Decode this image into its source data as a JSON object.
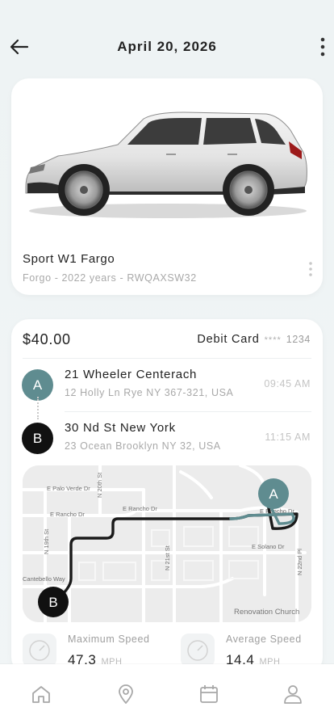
{
  "header": {
    "title": "April 20, 2026",
    "back_icon": "arrow-left-icon",
    "more_icon": "more-vertical-icon"
  },
  "vehicle": {
    "name": "Sport W1 Fargo",
    "meta": "Forgo - 2022 years - RWQAXSW32",
    "image": "suv-car-image"
  },
  "trip": {
    "price": "$40.00",
    "payment_method": "Debit Card",
    "card_mask": "****",
    "card_last4": "1234",
    "stops": [
      {
        "marker": "A",
        "name": "21 Wheeler Centerach",
        "address": "12 Holly Ln Rye NY 367-321, USA",
        "time": "09:45 AM"
      },
      {
        "marker": "B",
        "name": "30 Nd St New York",
        "address": "23 Ocean Brooklyn NY 32, USA",
        "time": "11:15 AM"
      }
    ],
    "map": {
      "streets": [
        "E Palo Verde Dr",
        "N 20th St",
        "E Rancho Dr",
        "E Rancho Dr",
        "E Rancho Dr",
        "N 19th St",
        "E Solano Dr",
        "N 21st St",
        "N 22nd Pl",
        "Cantebello Way",
        "Renovation Church"
      ],
      "marker_a": "A",
      "marker_b": "B",
      "route_color": "#111111",
      "route_tail_color": "#5f8c90"
    },
    "stats": [
      {
        "label": "Maximum Speed",
        "value": "47.3",
        "unit": "MPH",
        "icon": "speedometer-icon"
      },
      {
        "label": "Average Speed",
        "value": "14.4",
        "unit": "MPH",
        "icon": "speedometer-icon"
      }
    ]
  },
  "tabbar": {
    "items": [
      {
        "icon": "home-icon"
      },
      {
        "icon": "location-pin-icon"
      },
      {
        "icon": "calendar-icon"
      },
      {
        "icon": "profile-icon"
      }
    ]
  },
  "colors": {
    "accent": "#5f8c90",
    "background": "#eef3f4",
    "card": "#ffffff"
  }
}
